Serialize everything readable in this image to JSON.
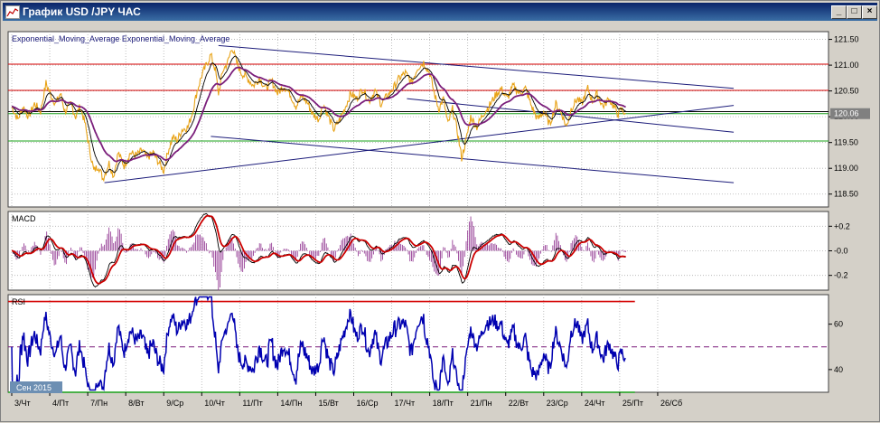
{
  "window": {
    "title": "График USD /JPY  ЧАС",
    "minimize_label": "_",
    "restore_label": "□",
    "close_label": "×"
  },
  "colors": {
    "price": "#e8a317",
    "ema_fast": "#000000",
    "ema_slow": "#7b1f7b",
    "trendline": "#1c1c7a",
    "level_red": "#d40000",
    "level_green": "#1aa01a",
    "macd_line": "#000000",
    "signal_line": "#cc0000",
    "histogram": "#8b2a8b",
    "rsi_line": "#0000b0"
  },
  "chart_data": [
    {
      "type": "line",
      "panel": "price",
      "title": "Exponential_Moving_Average Exponential_Moving_Average",
      "ylim": [
        118.25,
        121.65
      ],
      "yticks": [
        "121.50",
        "121.00",
        "120.50",
        "120.00",
        "119.50",
        "119.00",
        "118.50"
      ],
      "current_price_label": "120.06",
      "current_price": 120.06,
      "x_axis": {
        "range": [
          0,
          1070
        ],
        "ticks": [
          {
            "x": 0,
            "label": ""
          },
          {
            "x": 0,
            "label": "3/Чт"
          },
          {
            "x": 50,
            "label": "4/Пт"
          },
          {
            "x": 100,
            "label": "7/Пн"
          },
          {
            "x": 150,
            "label": "8/Вт"
          },
          {
            "x": 200,
            "label": "9/Ср"
          },
          {
            "x": 250,
            "label": "10/Чт"
          },
          {
            "x": 300,
            "label": "11/Пт"
          },
          {
            "x": 350,
            "label": "14/Пн"
          },
          {
            "x": 400,
            "label": "15/Вт"
          },
          {
            "x": 450,
            "label": "16/Ср"
          },
          {
            "x": 500,
            "label": "17/Чт"
          },
          {
            "x": 550,
            "label": "18/Пт"
          },
          {
            "x": 600,
            "label": "21/Пн"
          },
          {
            "x": 650,
            "label": "22/Вт"
          },
          {
            "x": 700,
            "label": "23/Ср"
          },
          {
            "x": 750,
            "label": "24/Чт"
          },
          {
            "x": 800,
            "label": "25/Пт"
          },
          {
            "x": 850,
            "label": "26/Сб"
          }
        ]
      },
      "horizontal_levels": [
        {
          "y": 121.02,
          "color": "#d40000"
        },
        {
          "y": 120.51,
          "color": "#d40000"
        },
        {
          "y": 120.06,
          "color": "#1aa01a"
        },
        {
          "y": 119.53,
          "color": "#1aa01a"
        },
        {
          "y": 120.1,
          "color": "#000000"
        }
      ],
      "trendlines": [
        {
          "from": [
            272,
            121.38
          ],
          "to": [
            950,
            120.55
          ]
        },
        {
          "from": [
            122,
            118.72
          ],
          "to": [
            950,
            120.22
          ]
        },
        {
          "from": [
            262,
            119.62
          ],
          "to": [
            950,
            118.72
          ]
        },
        {
          "from": [
            520,
            120.35
          ],
          "to": [
            950,
            119.7
          ]
        }
      ],
      "price_anchors": [
        [
          0,
          120.2
        ],
        [
          8,
          119.95
        ],
        [
          15,
          120.2
        ],
        [
          22,
          120.0
        ],
        [
          30,
          120.25
        ],
        [
          38,
          120.1
        ],
        [
          45,
          120.65
        ],
        [
          52,
          120.4
        ],
        [
          58,
          120.25
        ],
        [
          64,
          120.45
        ],
        [
          70,
          120.1
        ],
        [
          78,
          120.25
        ],
        [
          84,
          120.0
        ],
        [
          90,
          120.2
        ],
        [
          96,
          119.9
        ],
        [
          102,
          119.4
        ],
        [
          108,
          118.95
        ],
        [
          114,
          119.05
        ],
        [
          120,
          118.8
        ],
        [
          128,
          119.1
        ],
        [
          134,
          118.85
        ],
        [
          140,
          119.3
        ],
        [
          148,
          119.05
        ],
        [
          156,
          119.3
        ],
        [
          164,
          119.25
        ],
        [
          172,
          119.35
        ],
        [
          178,
          119.2
        ],
        [
          186,
          119.3
        ],
        [
          194,
          119.1
        ],
        [
          200,
          118.95
        ],
        [
          206,
          119.35
        ],
        [
          212,
          119.6
        ],
        [
          218,
          119.55
        ],
        [
          224,
          119.75
        ],
        [
          232,
          119.8
        ],
        [
          238,
          120.1
        ],
        [
          244,
          120.5
        ],
        [
          250,
          120.8
        ],
        [
          256,
          121.0
        ],
        [
          262,
          121.2
        ],
        [
          268,
          120.9
        ],
        [
          272,
          120.45
        ],
        [
          278,
          120.9
        ],
        [
          284,
          121.05
        ],
        [
          290,
          121.35
        ],
        [
          296,
          121.05
        ],
        [
          302,
          120.85
        ],
        [
          310,
          120.75
        ],
        [
          318,
          120.6
        ],
        [
          326,
          120.75
        ],
        [
          334,
          120.55
        ],
        [
          342,
          120.7
        ],
        [
          350,
          120.45
        ],
        [
          358,
          120.6
        ],
        [
          366,
          120.45
        ],
        [
          374,
          120.2
        ],
        [
          382,
          120.4
        ],
        [
          390,
          120.25
        ],
        [
          396,
          120.05
        ],
        [
          404,
          119.95
        ],
        [
          410,
          120.25
        ],
        [
          418,
          119.95
        ],
        [
          424,
          119.75
        ],
        [
          430,
          119.9
        ],
        [
          438,
          120.15
        ],
        [
          446,
          120.45
        ],
        [
          454,
          120.35
        ],
        [
          462,
          120.55
        ],
        [
          470,
          120.3
        ],
        [
          478,
          120.5
        ],
        [
          486,
          120.25
        ],
        [
          494,
          120.4
        ],
        [
          502,
          120.55
        ],
        [
          510,
          120.75
        ],
        [
          518,
          120.85
        ],
        [
          526,
          120.65
        ],
        [
          534,
          120.95
        ],
        [
          542,
          121.05
        ],
        [
          550,
          120.85
        ],
        [
          556,
          120.45
        ],
        [
          562,
          120.15
        ],
        [
          568,
          120.35
        ],
        [
          574,
          119.85
        ],
        [
          580,
          120.15
        ],
        [
          586,
          119.75
        ],
        [
          592,
          119.2
        ],
        [
          598,
          119.55
        ],
        [
          604,
          120.0
        ],
        [
          612,
          119.8
        ],
        [
          620,
          120.05
        ],
        [
          628,
          120.2
        ],
        [
          636,
          120.4
        ],
        [
          644,
          120.55
        ],
        [
          652,
          120.35
        ],
        [
          660,
          120.6
        ],
        [
          668,
          120.45
        ],
        [
          676,
          120.55
        ],
        [
          684,
          120.2
        ],
        [
          692,
          119.95
        ],
        [
          700,
          120.1
        ],
        [
          708,
          119.85
        ],
        [
          716,
          120.25
        ],
        [
          724,
          120.05
        ],
        [
          730,
          119.8
        ],
        [
          736,
          120.15
        ],
        [
          744,
          120.35
        ],
        [
          750,
          120.25
        ],
        [
          758,
          120.55
        ],
        [
          764,
          120.3
        ],
        [
          770,
          120.45
        ],
        [
          778,
          120.2
        ],
        [
          786,
          120.35
        ],
        [
          792,
          120.2
        ],
        [
          798,
          120.05
        ],
        [
          802,
          120.15
        ],
        [
          808,
          120.06
        ]
      ]
    },
    {
      "type": "line",
      "panel": "macd",
      "title": "MACD",
      "ylim": [
        -0.32,
        0.32
      ],
      "yticks": [
        "+0.2",
        "-0.0",
        "-0.2"
      ],
      "ytick_values": [
        0.2,
        0.0,
        -0.2
      ],
      "series": [
        "macd_line",
        "signal_line",
        "histogram"
      ]
    },
    {
      "type": "line",
      "panel": "rsi",
      "title": "RSI",
      "ylim": [
        30,
        73
      ],
      "yticks": [
        "60",
        "40"
      ],
      "ytick_values": [
        60,
        40
      ],
      "levels": [
        {
          "y": 70,
          "color": "#d40000"
        },
        {
          "y": 50,
          "color": "#7b1f7b",
          "dashed": true
        },
        {
          "y": 30,
          "color": "#1aa01a"
        }
      ]
    }
  ],
  "tooltip_date": "Сен 2015"
}
